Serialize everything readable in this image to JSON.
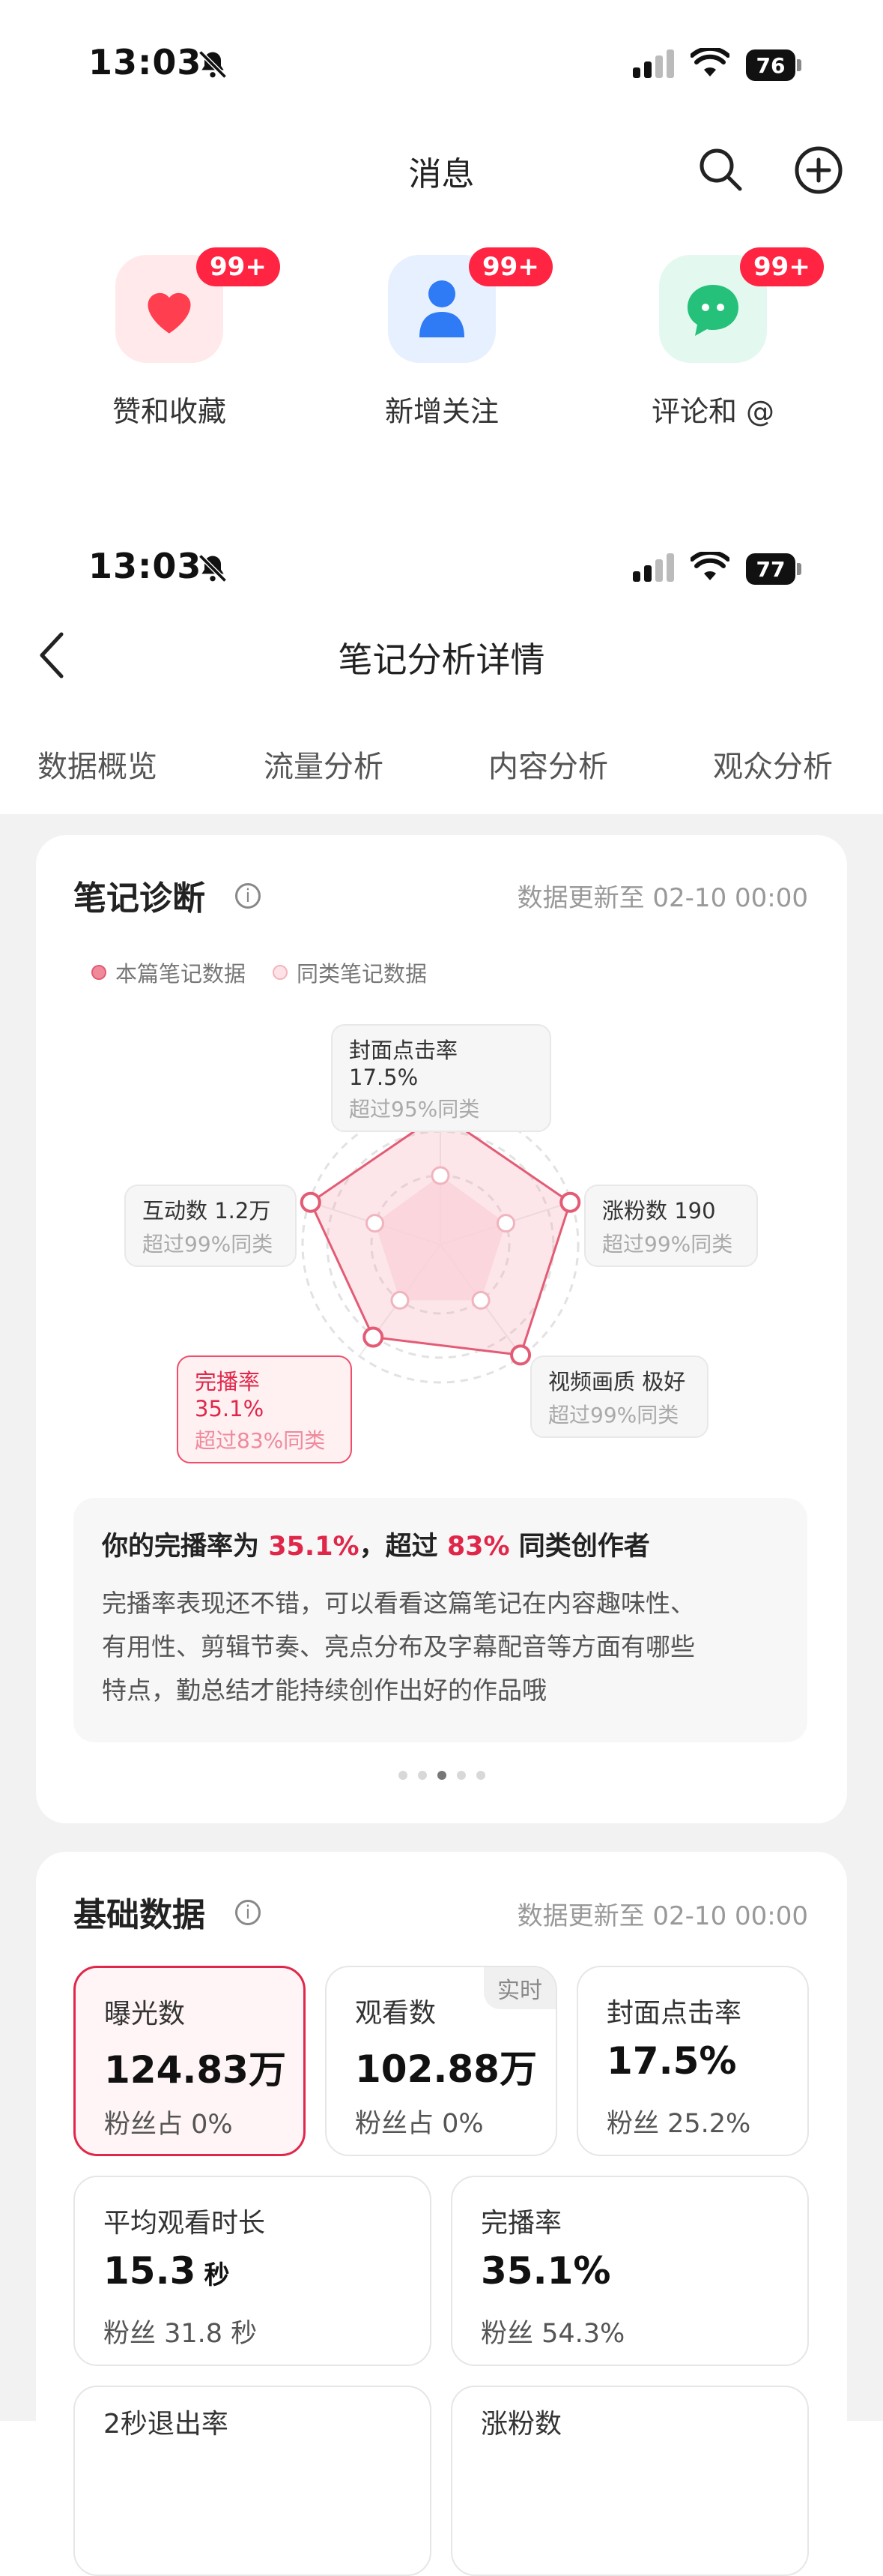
{
  "status_bar_1": {
    "time": "13:03",
    "battery": "76"
  },
  "messages": {
    "title": "消息",
    "tiles": [
      {
        "label": "赞和收藏",
        "badge": "99+"
      },
      {
        "label": "新增关注",
        "badge": "99+"
      },
      {
        "label": "评论和 @",
        "badge": "99+"
      }
    ]
  },
  "status_bar_2": {
    "time": "13:03",
    "battery": "77"
  },
  "header": {
    "title": "笔记分析详情"
  },
  "tabs": [
    "数据概览",
    "流量分析",
    "内容分析",
    "观众分析"
  ],
  "diagnosis": {
    "title": "笔记诊断",
    "updated": "数据更新至 02-10 00:00",
    "legend": [
      "本篇笔记数据",
      "同类笔记数据"
    ],
    "radar": [
      {
        "name": "封面点击率 17.5%",
        "sub": "超过95%同类"
      },
      {
        "name": "涨粉数 190",
        "sub": "超过99%同类"
      },
      {
        "name": "视频画质 极好",
        "sub": "超过99%同类"
      },
      {
        "name": "完播率 35.1%",
        "sub": "超过83%同类"
      },
      {
        "name": "互动数 1.2万",
        "sub": "超过99%同类"
      }
    ],
    "radar_values": {
      "this_note": [
        0.95,
        0.99,
        0.99,
        0.83,
        0.99
      ],
      "peer": [
        0.5,
        0.5,
        0.5,
        0.5,
        0.5
      ]
    },
    "summary": {
      "head_pre": "你的完播率为 ",
      "rate": "35.1%",
      "head_mid": "，超过 ",
      "pct": "83%",
      "head_post": " 同类创作者",
      "lines": [
        "完播率表现还不错，可以看看这篇笔记在内容趣味性、",
        "有用性、剪辑节奏、亮点分布及字幕配音等方面有哪些",
        "特点，勤总结才能持续创作出好的作品哦"
      ]
    },
    "page_dots": 5,
    "active_dot": 2
  },
  "basic": {
    "title": "基础数据",
    "updated": "数据更新至 02-10 00:00",
    "realtime_tag": "实时",
    "stats": [
      {
        "name": "曝光数",
        "value": "124.83万",
        "unit": "",
        "sub": "粉丝占 0%"
      },
      {
        "name": "观看数",
        "value": "102.88万",
        "unit": "",
        "sub": "粉丝占 0%"
      },
      {
        "name": "封面点击率",
        "value": "17.5%",
        "unit": "",
        "sub": "粉丝 25.2%"
      },
      {
        "name": "平均观看时长",
        "value": "15.3",
        "unit": "秒",
        "sub": "粉丝 31.8 秒"
      },
      {
        "name": "完播率",
        "value": "35.1%",
        "unit": "",
        "sub": "粉丝 54.3%"
      },
      {
        "name": "2秒退出率",
        "value": "",
        "unit": "",
        "sub": ""
      },
      {
        "name": "涨粉数",
        "value": "",
        "unit": "",
        "sub": ""
      }
    ]
  },
  "colors": {
    "accent": "#e0274a",
    "badge": "#ff2442",
    "background_gray": "#f2f2f2"
  }
}
